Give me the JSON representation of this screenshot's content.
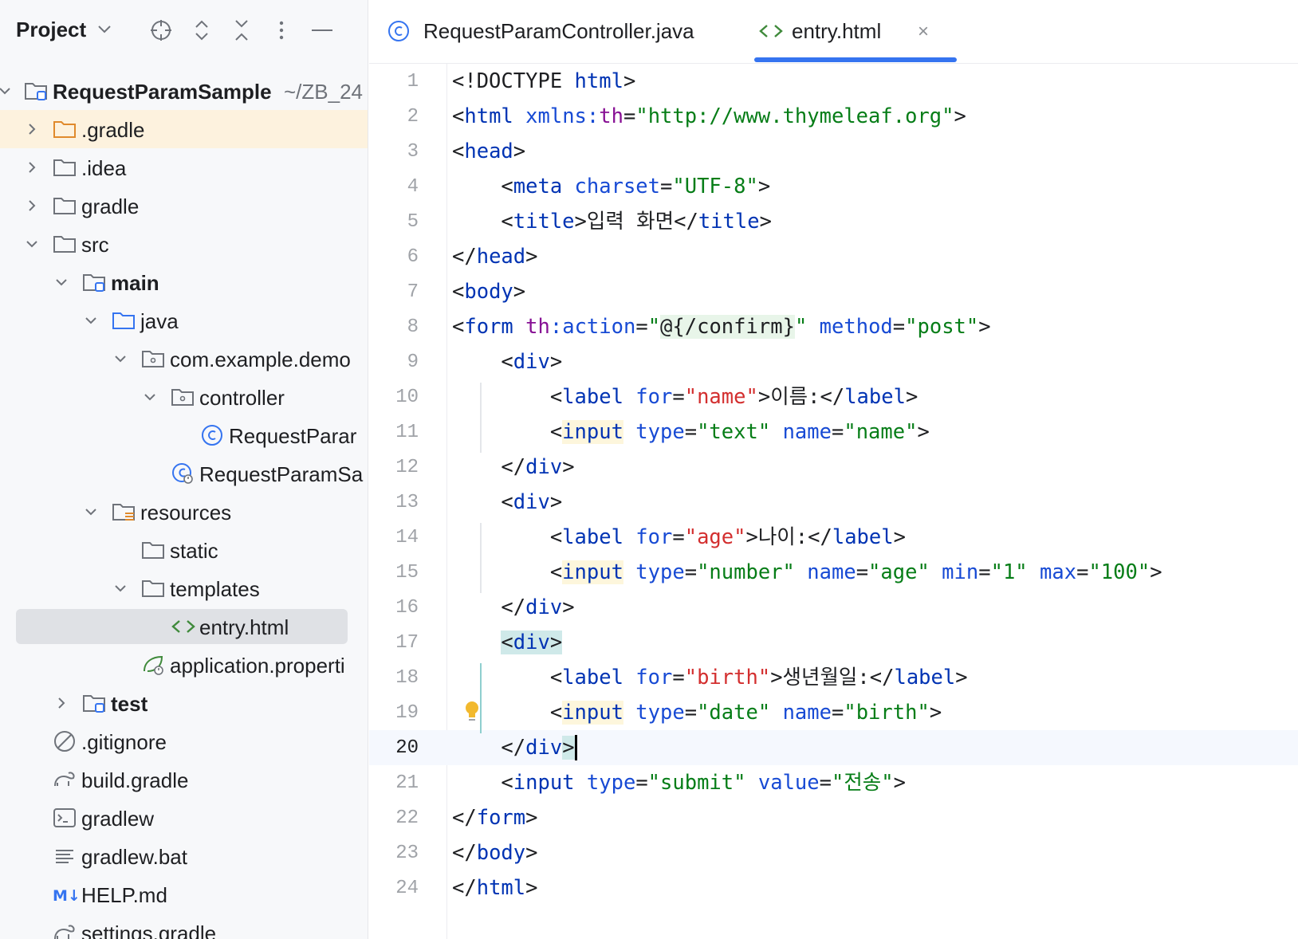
{
  "project_panel": {
    "title": "Project",
    "tree": [
      {
        "label": "RequestParamSample",
        "suffix": "~/ZB_24",
        "icon": "module-folder-icon",
        "expanded": true,
        "bold": true
      },
      {
        "label": ".gradle",
        "icon": "folder-orange-icon",
        "expanded": false
      },
      {
        "label": ".idea",
        "icon": "folder-icon",
        "expanded": false
      },
      {
        "label": "gradle",
        "icon": "folder-icon",
        "expanded": false
      },
      {
        "label": "src",
        "icon": "folder-icon",
        "expanded": true
      },
      {
        "label": "main",
        "icon": "module-folder-icon",
        "expanded": true,
        "bold": true
      },
      {
        "label": "java",
        "icon": "source-folder-icon",
        "expanded": true
      },
      {
        "label": "com.example.demo",
        "icon": "package-icon",
        "expanded": true
      },
      {
        "label": "controller",
        "icon": "package-icon",
        "expanded": true
      },
      {
        "label": "RequestParar",
        "icon": "class-icon"
      },
      {
        "label": "RequestParamSa",
        "icon": "spring-class-icon"
      },
      {
        "label": "resources",
        "icon": "resources-folder-icon",
        "expanded": true
      },
      {
        "label": "static",
        "icon": "folder-icon"
      },
      {
        "label": "templates",
        "icon": "folder-icon",
        "expanded": true
      },
      {
        "label": "entry.html",
        "icon": "html-icon",
        "selected": true
      },
      {
        "label": "application.properti",
        "icon": "spring-properties-icon"
      },
      {
        "label": "test",
        "icon": "module-folder-icon",
        "expanded": false,
        "bold": true
      },
      {
        "label": ".gitignore",
        "icon": "ignore-icon"
      },
      {
        "label": "build.gradle",
        "icon": "gradle-icon"
      },
      {
        "label": "gradlew",
        "icon": "terminal-icon"
      },
      {
        "label": "gradlew.bat",
        "icon": "text-lines-icon"
      },
      {
        "label": "HELP.md",
        "icon": "markdown-icon"
      },
      {
        "label": "settings.gradle",
        "icon": "gradle-icon"
      }
    ]
  },
  "tabs": [
    {
      "label": "RequestParamController.java",
      "icon": "class-icon",
      "active": false
    },
    {
      "label": "entry.html",
      "icon": "html-icon",
      "active": true,
      "close": "×"
    }
  ],
  "editor": {
    "current_line": 20,
    "lines": [
      {
        "n": "1",
        "tokens": [
          [
            "punct",
            "<!DOCTYPE "
          ],
          [
            "tag",
            "html"
          ],
          [
            "punct",
            ">"
          ]
        ]
      },
      {
        "n": "2",
        "tokens": [
          [
            "punct",
            "<"
          ],
          [
            "tag",
            "html"
          ],
          [
            "punct",
            " "
          ],
          [
            "attr",
            "xmlns:"
          ],
          [
            "thval",
            "th"
          ],
          [
            "punct",
            "="
          ],
          [
            "val",
            "\"http://www.thymeleaf.org\""
          ],
          [
            "punct",
            ">"
          ]
        ]
      },
      {
        "n": "3",
        "tokens": [
          [
            "punct",
            "<"
          ],
          [
            "tag",
            "head"
          ],
          [
            "punct",
            ">"
          ]
        ]
      },
      {
        "n": "4",
        "tokens": [
          [
            "punct",
            "    <"
          ],
          [
            "tag",
            "meta"
          ],
          [
            "punct",
            " "
          ],
          [
            "attr",
            "charset"
          ],
          [
            "punct",
            "="
          ],
          [
            "val",
            "\"UTF-8\""
          ],
          [
            "punct",
            ">"
          ]
        ]
      },
      {
        "n": "5",
        "tokens": [
          [
            "punct",
            "    <"
          ],
          [
            "tag",
            "title"
          ],
          [
            "punct",
            ">"
          ],
          [
            "txt",
            "입력 화면"
          ],
          [
            "punct",
            "</"
          ],
          [
            "tag",
            "title"
          ],
          [
            "punct",
            ">"
          ]
        ]
      },
      {
        "n": "6",
        "tokens": [
          [
            "punct",
            "</"
          ],
          [
            "tag",
            "head"
          ],
          [
            "punct",
            ">"
          ]
        ]
      },
      {
        "n": "7",
        "tokens": [
          [
            "punct",
            "<"
          ],
          [
            "tag",
            "body"
          ],
          [
            "punct",
            ">"
          ]
        ]
      },
      {
        "n": "8",
        "tokens": [
          [
            "punct",
            "<"
          ],
          [
            "tag",
            "form"
          ],
          [
            "punct",
            " "
          ],
          [
            "thval",
            "th"
          ],
          [
            "attr",
            ":action"
          ],
          [
            "punct",
            "="
          ],
          [
            "val",
            "\""
          ],
          [
            "txt hl-green",
            "@{/confirm}"
          ],
          [
            "val",
            "\""
          ],
          [
            "punct",
            " "
          ],
          [
            "attr",
            "method"
          ],
          [
            "punct",
            "="
          ],
          [
            "val",
            "\"post\""
          ],
          [
            "punct",
            ">"
          ]
        ]
      },
      {
        "n": "9",
        "tokens": [
          [
            "punct",
            "    <"
          ],
          [
            "tag",
            "div"
          ],
          [
            "punct",
            ">"
          ]
        ]
      },
      {
        "n": "10",
        "tokens": [
          [
            "punct",
            "        <"
          ],
          [
            "tag",
            "label"
          ],
          [
            "punct",
            " "
          ],
          [
            "attr",
            "for"
          ],
          [
            "punct",
            "="
          ],
          [
            "valred",
            "\"name\""
          ],
          [
            "punct",
            ">"
          ],
          [
            "txt",
            "이름:"
          ],
          [
            "punct",
            "</"
          ],
          [
            "tag",
            "label"
          ],
          [
            "punct",
            ">"
          ]
        ]
      },
      {
        "n": "11",
        "tokens": [
          [
            "punct",
            "        <"
          ],
          [
            "tag hl-yellow",
            "input"
          ],
          [
            "punct",
            " "
          ],
          [
            "attr",
            "type"
          ],
          [
            "punct",
            "="
          ],
          [
            "val",
            "\"text\""
          ],
          [
            "punct",
            " "
          ],
          [
            "attr",
            "name"
          ],
          [
            "punct",
            "="
          ],
          [
            "val",
            "\"name\""
          ],
          [
            "punct",
            ">"
          ]
        ]
      },
      {
        "n": "12",
        "tokens": [
          [
            "punct",
            "    </"
          ],
          [
            "tag",
            "div"
          ],
          [
            "punct",
            ">"
          ]
        ]
      },
      {
        "n": "13",
        "tokens": [
          [
            "punct",
            "    <"
          ],
          [
            "tag",
            "div"
          ],
          [
            "punct",
            ">"
          ]
        ]
      },
      {
        "n": "14",
        "tokens": [
          [
            "punct",
            "        <"
          ],
          [
            "tag",
            "label"
          ],
          [
            "punct",
            " "
          ],
          [
            "attr",
            "for"
          ],
          [
            "punct",
            "="
          ],
          [
            "valred",
            "\"age\""
          ],
          [
            "punct",
            ">"
          ],
          [
            "txt",
            "나이:"
          ],
          [
            "punct",
            "</"
          ],
          [
            "tag",
            "label"
          ],
          [
            "punct",
            ">"
          ]
        ]
      },
      {
        "n": "15",
        "tokens": [
          [
            "punct",
            "        <"
          ],
          [
            "tag hl-yellow",
            "input"
          ],
          [
            "punct",
            " "
          ],
          [
            "attr",
            "type"
          ],
          [
            "punct",
            "="
          ],
          [
            "val",
            "\"number\""
          ],
          [
            "punct",
            " "
          ],
          [
            "attr",
            "name"
          ],
          [
            "punct",
            "="
          ],
          [
            "val",
            "\"age\""
          ],
          [
            "punct",
            " "
          ],
          [
            "attr",
            "min"
          ],
          [
            "punct",
            "="
          ],
          [
            "val",
            "\"1\""
          ],
          [
            "punct",
            " "
          ],
          [
            "attr",
            "max"
          ],
          [
            "punct",
            "="
          ],
          [
            "val",
            "\"100\""
          ],
          [
            "punct",
            ">"
          ]
        ]
      },
      {
        "n": "16",
        "tokens": [
          [
            "punct",
            "    </"
          ],
          [
            "tag",
            "div"
          ],
          [
            "punct",
            ">"
          ]
        ]
      },
      {
        "n": "17",
        "tokens": [
          [
            "punct",
            "    "
          ],
          [
            "punct hl-teal",
            "<"
          ],
          [
            "tag hl-teal",
            "div"
          ],
          [
            "punct hl-teal",
            ">"
          ]
        ]
      },
      {
        "n": "18",
        "tokens": [
          [
            "punct",
            "        <"
          ],
          [
            "tag",
            "label"
          ],
          [
            "punct",
            " "
          ],
          [
            "attr",
            "for"
          ],
          [
            "punct",
            "="
          ],
          [
            "valred",
            "\"birth\""
          ],
          [
            "punct",
            ">"
          ],
          [
            "txt",
            "생년월일:"
          ],
          [
            "punct",
            "</"
          ],
          [
            "tag",
            "label"
          ],
          [
            "punct",
            ">"
          ]
        ]
      },
      {
        "n": "19",
        "tokens": [
          [
            "punct",
            "        <"
          ],
          [
            "tag hl-yellow",
            "input"
          ],
          [
            "punct",
            " "
          ],
          [
            "attr",
            "type"
          ],
          [
            "punct",
            "="
          ],
          [
            "val",
            "\"date\""
          ],
          [
            "punct",
            " "
          ],
          [
            "attr",
            "name"
          ],
          [
            "punct",
            "="
          ],
          [
            "val",
            "\"birth\""
          ],
          [
            "punct",
            ">"
          ]
        ]
      },
      {
        "n": "20",
        "tokens": [
          [
            "punct",
            "    </"
          ],
          [
            "tag",
            "div"
          ],
          [
            "punct hl-teal",
            ">"
          ]
        ]
      },
      {
        "n": "21",
        "tokens": [
          [
            "punct",
            "    <"
          ],
          [
            "tag",
            "input"
          ],
          [
            "punct",
            " "
          ],
          [
            "attr",
            "type"
          ],
          [
            "punct",
            "="
          ],
          [
            "val",
            "\"submit\""
          ],
          [
            "punct",
            " "
          ],
          [
            "attr",
            "value"
          ],
          [
            "punct",
            "="
          ],
          [
            "val",
            "\"전송\""
          ],
          [
            "punct",
            ">"
          ]
        ]
      },
      {
        "n": "22",
        "tokens": [
          [
            "punct",
            "</"
          ],
          [
            "tag",
            "form"
          ],
          [
            "punct",
            ">"
          ]
        ]
      },
      {
        "n": "23",
        "tokens": [
          [
            "punct",
            "</"
          ],
          [
            "tag",
            "body"
          ],
          [
            "punct",
            ">"
          ]
        ]
      },
      {
        "n": "24",
        "tokens": [
          [
            "punct",
            "</"
          ],
          [
            "tag",
            "html"
          ],
          [
            "punct",
            ">"
          ]
        ]
      }
    ]
  }
}
